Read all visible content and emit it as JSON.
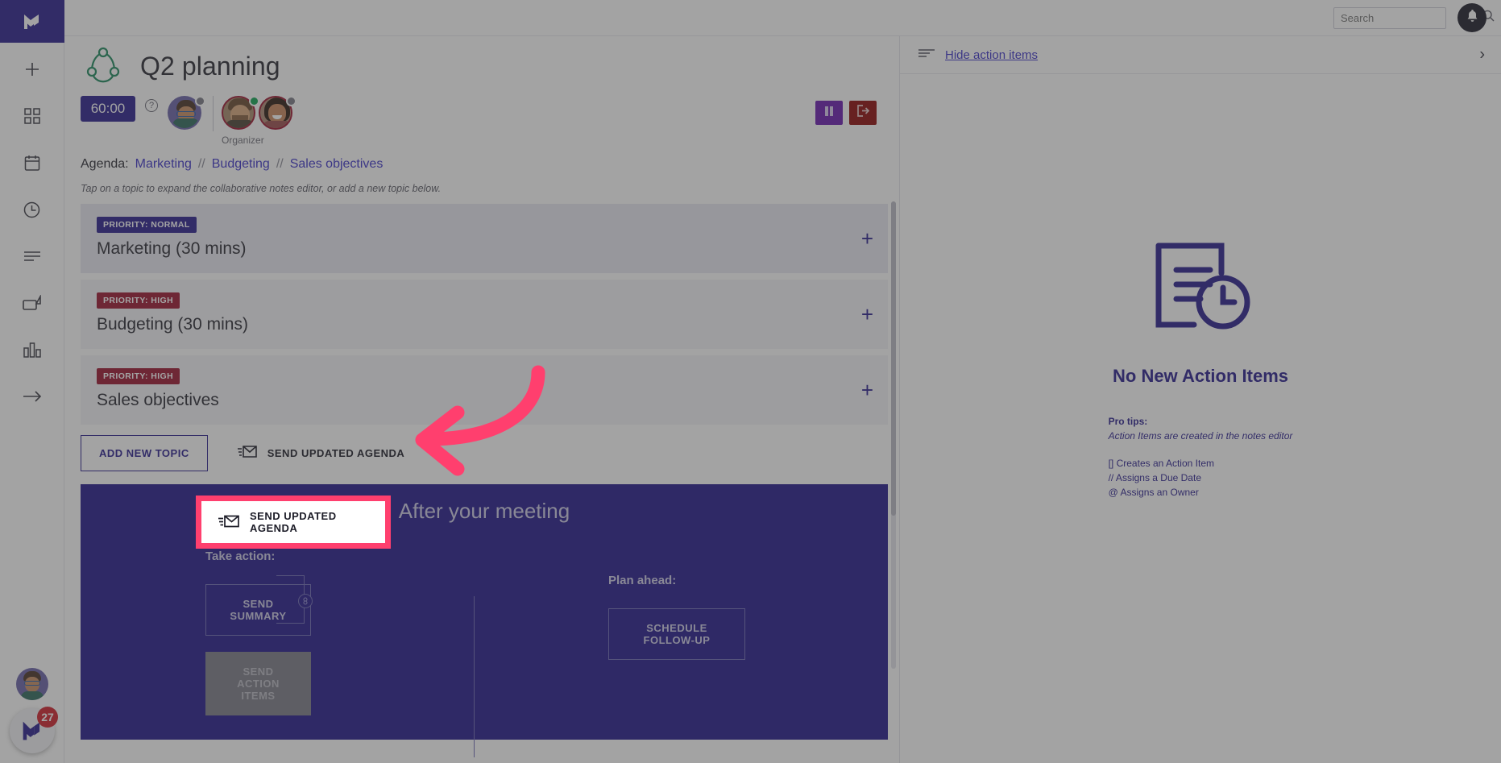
{
  "app": {
    "brand_color": "#2a1f8f",
    "accent_pink": "#ff3f6e",
    "logo_name": "meetingpulse-logo"
  },
  "topbar": {
    "search_placeholder": "Search",
    "search_value": "",
    "search_icon": "search-icon",
    "bell_icon": "bell-icon"
  },
  "sidebar": {
    "items": [
      {
        "icon": "plus-icon",
        "label": "New"
      },
      {
        "icon": "grid-icon",
        "label": "Dashboard"
      },
      {
        "icon": "calendar-icon",
        "label": "Calendar"
      },
      {
        "icon": "clock-icon",
        "label": "History"
      },
      {
        "icon": "list-icon",
        "label": "Notes"
      },
      {
        "icon": "video-icon",
        "label": "Meetings"
      },
      {
        "icon": "bar-chart-icon",
        "label": "Analytics"
      },
      {
        "icon": "arrow-right-icon",
        "label": "Collapse"
      }
    ],
    "badge_count": "27",
    "avatar_name": "user-avatar"
  },
  "meeting": {
    "title": "Q2 planning",
    "logo_icon": "meeting-circle-icon",
    "timer": "60:00",
    "help_icon": "help-icon",
    "organizer_label": "Organizer",
    "participants": [
      {
        "name": "avatar-self",
        "status": "grey",
        "ring": false
      },
      {
        "name": "avatar-organizer",
        "status": "green",
        "ring": true
      },
      {
        "name": "avatar-participant",
        "status": "grey",
        "ring": true
      }
    ],
    "controls": [
      {
        "name": "pause-button",
        "icon": "pause-icon",
        "color": "#6a1bb0"
      },
      {
        "name": "exit-button",
        "icon": "exit-icon",
        "color": "#8e0b0b"
      }
    ],
    "agenda_label": "Agenda:",
    "agenda_links": [
      "Marketing",
      "Budgeting",
      "Sales objectives"
    ],
    "agenda_separator": "//",
    "hint": "Tap on a topic to expand the collaborative notes editor, or add a new topic below."
  },
  "topics": [
    {
      "priority": "PRIORITY: NORMAL",
      "priority_level": "normal",
      "name": "Marketing (30 mins)",
      "add_icon": "plus-icon",
      "active": true
    },
    {
      "priority": "PRIORITY: HIGH",
      "priority_level": "high",
      "name": "Budgeting (30 mins)",
      "add_icon": "plus-icon",
      "active": false
    },
    {
      "priority": "PRIORITY: HIGH",
      "priority_level": "high",
      "name": "Sales objectives",
      "add_icon": "plus-icon",
      "active": false
    }
  ],
  "actions": {
    "add_new_topic": "ADD NEW TOPIC",
    "send_updated_agenda": "SEND UPDATED AGENDA",
    "send_icon": "send-envelope-icon"
  },
  "after_meeting": {
    "heading": "After your meeting",
    "take_action_label": "Take action:",
    "plan_ahead_label": "Plan ahead:",
    "send_summary": "SEND SUMMARY",
    "send_action_items": "SEND ACTION ITEMS",
    "schedule_follow_up": "SCHEDULE FOLLOW-UP",
    "link_icon": "chain-link-icon"
  },
  "right_panel": {
    "toggle_label": "Hide action items",
    "toggle_icon": "list-lines-icon",
    "collapse_icon": "chevron-right-icon",
    "empty_icon": "document-clock-icon",
    "empty_title": "No New Action Items",
    "tips_heading": "Pro tips:",
    "tips_subtitle": "Action Items are created in the notes editor",
    "tips": [
      "[] Creates an Action Item",
      "// Assigns a Due Date",
      "@ Assigns an Owner"
    ]
  },
  "annotation": {
    "highlight_target": "send-updated-agenda-button",
    "arrow_icon": "curved-arrow-left-icon"
  }
}
